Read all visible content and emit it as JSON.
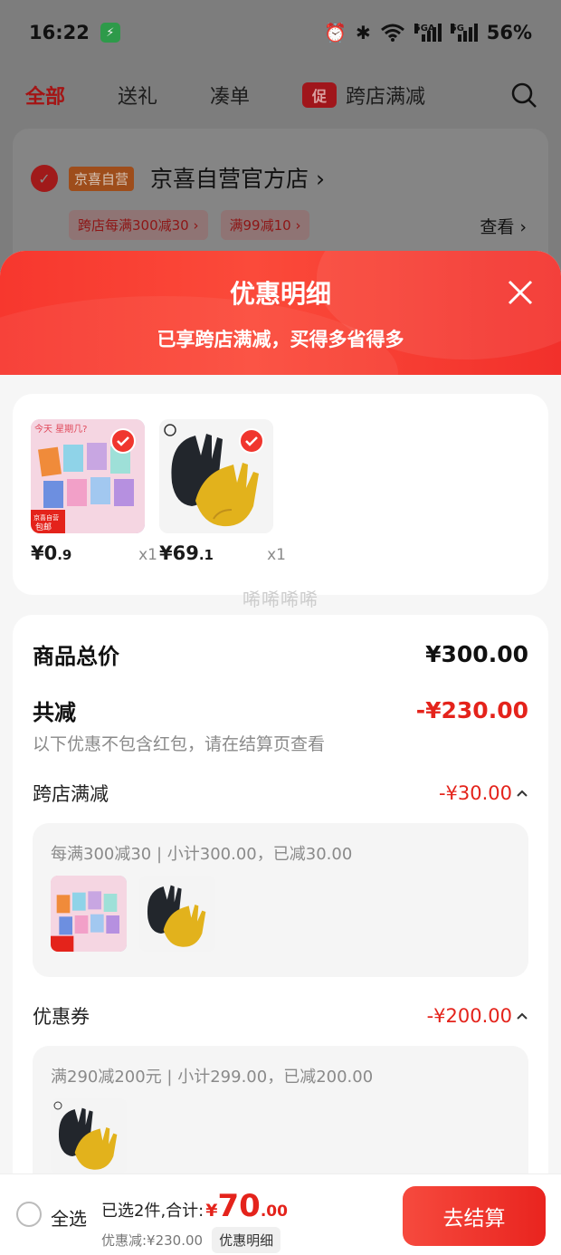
{
  "status_bar": {
    "time": "16:22",
    "signal_1": "5GA",
    "signal_2": "5G",
    "battery": "56%"
  },
  "tabs": {
    "all": "全部",
    "gift": "送礼",
    "combine": "凑单",
    "promo_tag": "促",
    "cross_store": "跨店满减"
  },
  "store": {
    "badge": "京喜自营",
    "name": "京喜自营官方店 ›",
    "tags": [
      "跨店每满300减30 ›",
      "满99减10 ›"
    ],
    "view": "查看 ›"
  },
  "sheet": {
    "title": "优惠明细",
    "subtitle": "已享跨店满减，买得多省得多"
  },
  "products": [
    {
      "price_int": "¥0",
      "price_dec": ".9",
      "qty": "x1",
      "overlay_line1": "京喜自营",
      "overlay_line2": "包邮",
      "image_text": "今天 星期几?"
    },
    {
      "price_int": "¥69",
      "price_dec": ".1",
      "qty": "x1"
    }
  ],
  "watermark": "唏唏唏唏",
  "summary": {
    "goods_total_label": "商品总价",
    "goods_total_value": "¥300.00",
    "discount_label": "共减",
    "discount_value": "-¥230.00",
    "note": "以下优惠不包含红包，请在结算页查看"
  },
  "cross_store": {
    "label": "跨店满减",
    "value": "-¥30.00",
    "detail": "每满300减30 | 小计300.00，已减30.00"
  },
  "coupon": {
    "label": "优惠券",
    "value": "-¥200.00",
    "detail": "满290减200元 | 小计299.00，已减200.00"
  },
  "bottom_bar": {
    "select_all": "全选",
    "selected_total_label": "已选2件,合计:",
    "currency": "¥",
    "total_int": "70",
    "total_dec": ".00",
    "saving": "优惠减:¥230.00",
    "detail_chip": "优惠明细",
    "checkout": "去结算"
  },
  "colors": {
    "accent_red": "#e4231b",
    "header_red": "#f7372e"
  }
}
